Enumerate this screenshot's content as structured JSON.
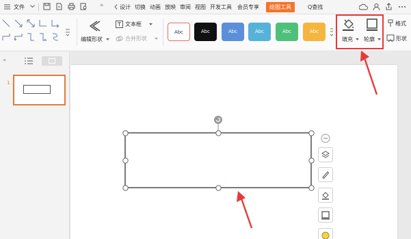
{
  "menu": {
    "file_label": "文件",
    "tabs": [
      "设计",
      "切换",
      "动画",
      "放映",
      "审阅",
      "视图",
      "开发工具",
      "会员专享"
    ],
    "active_tab": "绘图工具",
    "search_label": "Q查找"
  },
  "ribbon": {
    "edit_shape_label": "编辑形状",
    "textbox_label": "文本框",
    "merge_shape_label": "合并形状",
    "style_presets": [
      {
        "text": "Abc",
        "bg": "#ffffff",
        "fg": "#333333",
        "border": "#e36b6b"
      },
      {
        "text": "Abc",
        "bg": "#111111",
        "fg": "#ffffff",
        "border": "#111111"
      },
      {
        "text": "Abc",
        "bg": "#5b8fd8",
        "fg": "#ffffff",
        "border": "#5b8fd8"
      },
      {
        "text": "Abc",
        "bg": "#56b2d8",
        "fg": "#ffffff",
        "border": "#56b2d8"
      },
      {
        "text": "Abc",
        "bg": "#4fc07a",
        "fg": "#ffffff",
        "border": "#4fc07a"
      },
      {
        "text": "Abc",
        "bg": "#f5b640",
        "fg": "#ffffff",
        "border": "#f5b640"
      }
    ],
    "fill_label": "填充",
    "outline_label": "轮廓",
    "format_label": "格式",
    "shape_effect_label": "形状"
  },
  "slides_panel": {
    "slide_number": "1"
  },
  "colors": {
    "accent_orange": "#f5732c",
    "highlight_red": "#e8393a"
  }
}
